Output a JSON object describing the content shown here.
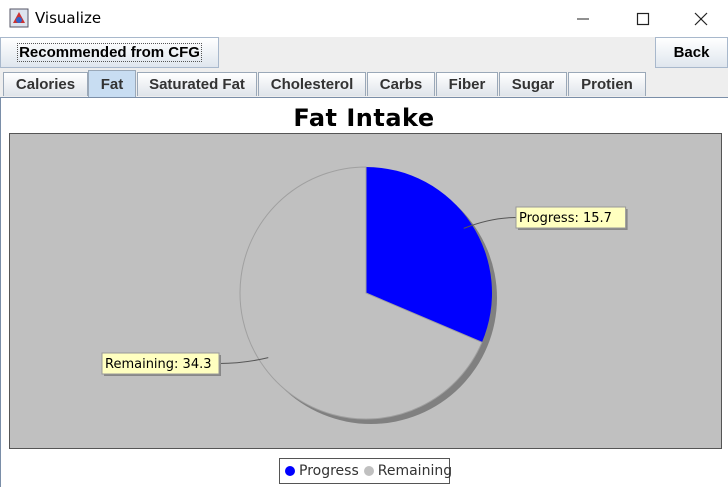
{
  "window": {
    "title": "Visualize",
    "controls": [
      "minimize",
      "maximize",
      "close"
    ]
  },
  "toolbar": {
    "recommended_label": "Recommended from CFG",
    "back_label": "Back"
  },
  "tabs": [
    {
      "label": "Calories"
    },
    {
      "label": "Fat",
      "active": true
    },
    {
      "label": "Saturated Fat"
    },
    {
      "label": "Cholesterol"
    },
    {
      "label": "Carbs"
    },
    {
      "label": "Fiber"
    },
    {
      "label": "Sugar"
    },
    {
      "label": "Protien"
    }
  ],
  "chart_data": {
    "type": "pie",
    "title": "Fat Intake",
    "slices": [
      {
        "name": "Progress",
        "value": 15.7,
        "label": "Progress: 15.7",
        "color": "#0000ff"
      },
      {
        "name": "Remaining",
        "value": 34.3,
        "label": "Remaining: 34.3",
        "color": "#c0c0c0"
      }
    ],
    "legend": {
      "position": "bottom",
      "entries": [
        "Progress",
        "Remaining"
      ]
    },
    "colors": {
      "plot_background": "#c0c0c0",
      "label_background": "#ffffc0"
    }
  }
}
